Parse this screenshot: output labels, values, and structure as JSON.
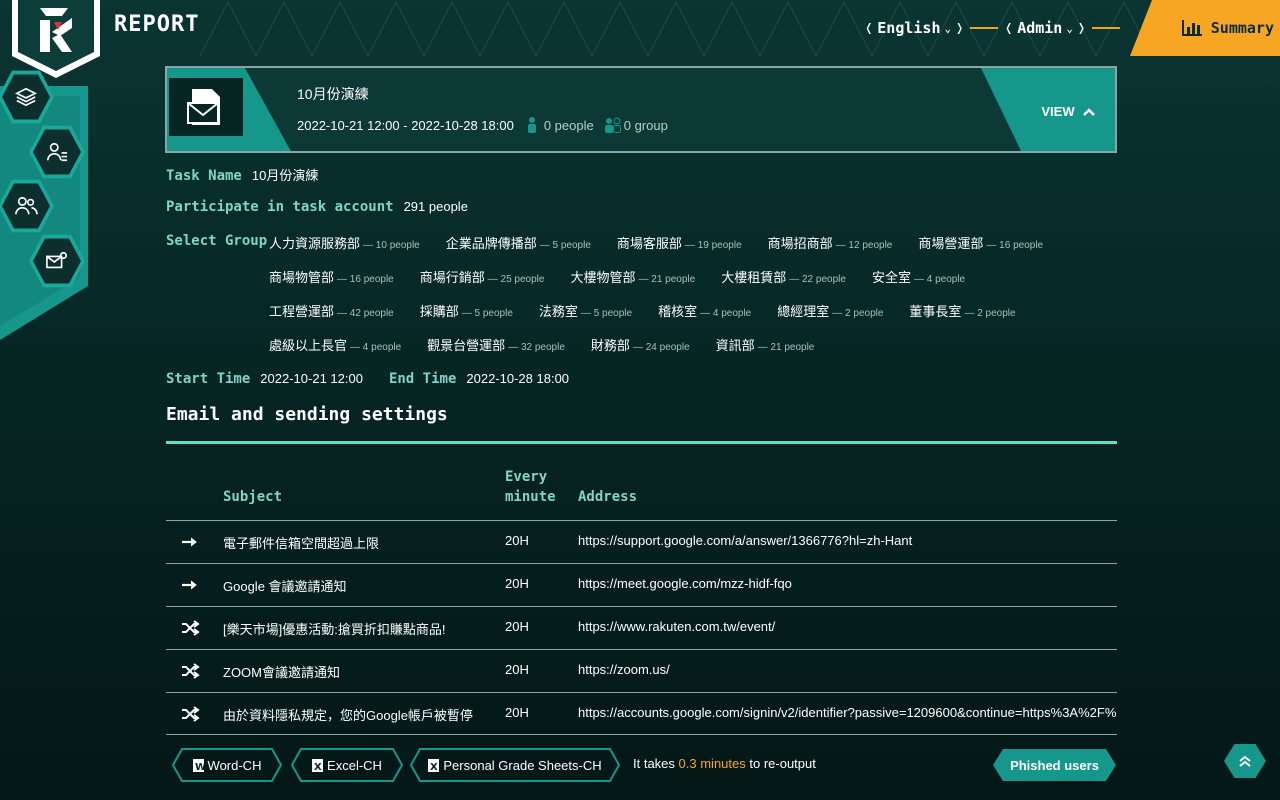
{
  "app": {
    "title": "REPORT"
  },
  "topnav": {
    "language": "English",
    "user": "Admin",
    "summary": "Summary"
  },
  "task": {
    "name": "10月份演練",
    "period": "2022-10-21 12:00 - 2022-10-28 18:00",
    "people": "0 people",
    "groups": "0 group",
    "view_label": "VIEW"
  },
  "details": {
    "task_name_label": "Task Name",
    "task_name_value": "10月份演練",
    "participate_label": "Participate in task account",
    "participate_value": "291 people",
    "select_group_label": "Select Group",
    "groups": [
      [
        {
          "name": "人力資源服務部",
          "count": "— 10 people"
        },
        {
          "name": "企業品牌傳播部",
          "count": "— 5 people"
        },
        {
          "name": "商場客服部",
          "count": "— 19 people"
        },
        {
          "name": "商場招商部",
          "count": "— 12 people"
        },
        {
          "name": "商場營運部",
          "count": "— 16 people"
        }
      ],
      [
        {
          "name": "商場物管部",
          "count": "— 16 people"
        },
        {
          "name": "商場行銷部",
          "count": "— 25 people"
        },
        {
          "name": "大樓物管部",
          "count": "— 21 people"
        },
        {
          "name": "大樓租賃部",
          "count": "— 22 people"
        },
        {
          "name": "安全室",
          "count": "— 4 people"
        }
      ],
      [
        {
          "name": "工程營運部",
          "count": "— 42 people"
        },
        {
          "name": "採購部",
          "count": "— 5 people"
        },
        {
          "name": "法務室",
          "count": "— 5 people"
        },
        {
          "name": "稽核室",
          "count": "— 4 people"
        },
        {
          "name": "總經理室",
          "count": "— 2 people"
        },
        {
          "name": "董事長室",
          "count": "— 2 people"
        }
      ],
      [
        {
          "name": "處級以上長官",
          "count": "— 4 people"
        },
        {
          "name": "觀景台營運部",
          "count": "— 32 people"
        },
        {
          "name": "財務部",
          "count": "— 24 people"
        },
        {
          "name": "資訊部",
          "count": "— 21 people"
        }
      ]
    ],
    "start_label": "Start Time",
    "start_value": "2022-10-21 12:00",
    "end_label": "End Time",
    "end_value": "2022-10-28 18:00"
  },
  "email_section": {
    "title": "Email and sending settings",
    "columns": {
      "subject": "Subject",
      "every_1": "Every",
      "every_2": "minute",
      "address": "Address"
    },
    "rows": [
      {
        "icon": "arrow-right-icon",
        "subject": "電子郵件信箱空間超過上限",
        "every": "20H",
        "address": "https://support.google.com/a/answer/1366776?hl=zh-Hant"
      },
      {
        "icon": "arrow-right-icon",
        "subject": "Google 會議邀請通知",
        "every": "20H",
        "address": "https://meet.google.com/mzz-hidf-fqo"
      },
      {
        "icon": "shuffle-icon",
        "subject": "[樂天市場]優惠活動:搶買折扣賺點商品!",
        "every": "20H",
        "address": "https://www.rakuten.com.tw/event/"
      },
      {
        "icon": "shuffle-icon",
        "subject": "ZOOM會議邀請通知",
        "every": "20H",
        "address": "https://zoom.us/"
      },
      {
        "icon": "shuffle-icon",
        "subject": "由於資料隱私規定，您的Google帳戶被暫停",
        "every": "20H",
        "address": "https://accounts.google.com/signin/v2/identifier?passive=1209600&continue=https%3A%2F%"
      }
    ]
  },
  "footer": {
    "word_btn": "Word-CH",
    "excel_btn": "Excel-CH",
    "grade_btn": "Personal Grade Sheets-CH",
    "rerun_prefix": "It takes",
    "rerun_value": "0.3 minutes",
    "rerun_suffix": "to re-output",
    "phished_btn": "Phished users"
  },
  "colors": {
    "accent": "#16978b",
    "highlight": "#f6a623",
    "label": "#7fd5c6",
    "rule": "#5ee0c7"
  }
}
